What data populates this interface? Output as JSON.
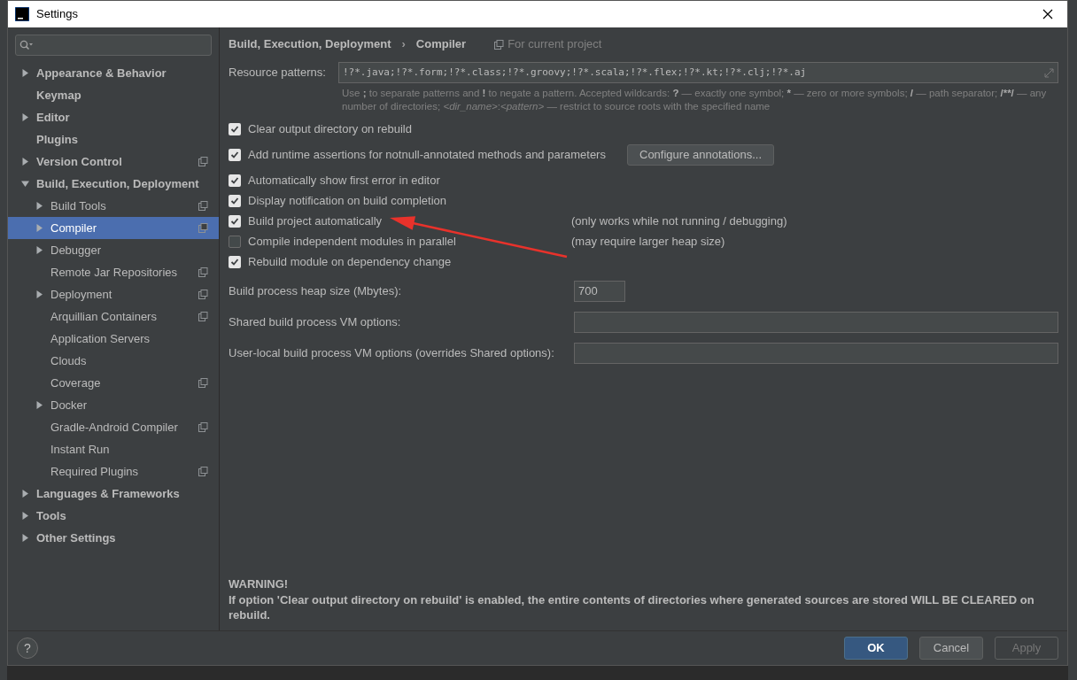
{
  "window": {
    "title": "Settings"
  },
  "sidebar": {
    "items": [
      {
        "label": "Appearance & Behavior",
        "expanded": false,
        "project": false,
        "selected": false
      },
      {
        "label": "Keymap",
        "project": false,
        "selected": false
      },
      {
        "label": "Editor",
        "expanded": false,
        "project": false,
        "selected": false
      },
      {
        "label": "Plugins",
        "project": false,
        "selected": false
      },
      {
        "label": "Version Control",
        "expanded": false,
        "project": true,
        "selected": false
      },
      {
        "label": "Build, Execution, Deployment",
        "expanded": true,
        "project": false,
        "selected": false,
        "children": [
          {
            "label": "Build Tools",
            "expanded": false,
            "project": true,
            "selected": false
          },
          {
            "label": "Compiler",
            "expanded": false,
            "project": true,
            "selected": true
          },
          {
            "label": "Debugger",
            "expanded": false,
            "project": false,
            "selected": false
          },
          {
            "label": "Remote Jar Repositories",
            "project": true,
            "selected": false
          },
          {
            "label": "Deployment",
            "expanded": false,
            "project": true,
            "selected": false
          },
          {
            "label": "Arquillian Containers",
            "project": true,
            "selected": false
          },
          {
            "label": "Application Servers",
            "project": false,
            "selected": false
          },
          {
            "label": "Clouds",
            "project": false,
            "selected": false
          },
          {
            "label": "Coverage",
            "project": true,
            "selected": false
          },
          {
            "label": "Docker",
            "expanded": false,
            "project": false,
            "selected": false
          },
          {
            "label": "Gradle-Android Compiler",
            "project": true,
            "selected": false
          },
          {
            "label": "Instant Run",
            "project": false,
            "selected": false
          },
          {
            "label": "Required Plugins",
            "project": true,
            "selected": false
          }
        ]
      },
      {
        "label": "Languages & Frameworks",
        "expanded": false,
        "project": false,
        "selected": false
      },
      {
        "label": "Tools",
        "expanded": false,
        "project": false,
        "selected": false
      },
      {
        "label": "Other Settings",
        "expanded": false,
        "project": false,
        "selected": false
      }
    ]
  },
  "breadcrumb": [
    "Build, Execution, Deployment",
    "›",
    "Compiler"
  ],
  "scope": "For current project",
  "resource_patterns": {
    "label": "Resource patterns:",
    "value": "!?*.java;!?*.form;!?*.class;!?*.groovy;!?*.scala;!?*.flex;!?*.kt;!?*.clj;!?*.aj",
    "hint": [
      {
        "text": "Use ",
        "kind": "text"
      },
      {
        "text": ";",
        "kind": "symbol"
      },
      {
        "text": " to separate patterns and ",
        "kind": "text"
      },
      {
        "text": "!",
        "kind": "symbol"
      },
      {
        "text": " to negate a pattern. Accepted wildcards: ",
        "kind": "text"
      },
      {
        "text": "?",
        "kind": "symbol"
      },
      {
        "text": " — exactly one symbol; ",
        "kind": "text"
      },
      {
        "text": "*",
        "kind": "symbol"
      },
      {
        "text": " — zero or more symbols; ",
        "kind": "text"
      },
      {
        "text": "/",
        "kind": "symbol"
      },
      {
        "text": " — path separator; ",
        "kind": "text"
      },
      {
        "text": "/**/",
        "kind": "symbol"
      },
      {
        "text": " — any number of directories; ",
        "kind": "text"
      },
      {
        "text": "<dir_name>",
        "kind": "placeholder"
      },
      {
        "text": ":",
        "kind": "text"
      },
      {
        "text": "<pattern>",
        "kind": "placeholder"
      },
      {
        "text": " — restrict to source roots with the specified name",
        "kind": "text"
      }
    ]
  },
  "options": [
    {
      "label": "Clear output directory on rebuild",
      "checked": true
    },
    {
      "label": "Add runtime assertions for notnull-annotated methods and parameters",
      "checked": true,
      "button": "Configure annotations..."
    },
    {
      "label": "Automatically show first error in editor",
      "checked": true
    },
    {
      "label": "Display notification on build completion",
      "checked": true
    },
    {
      "label": "Build project automatically",
      "checked": true,
      "note": "(only works while not running / debugging)"
    },
    {
      "label": "Compile independent modules in parallel",
      "checked": false,
      "note": "(may require larger heap size)"
    },
    {
      "label": "Rebuild module on dependency change",
      "checked": true
    }
  ],
  "fields": [
    {
      "label": "Build process heap size (Mbytes):",
      "value": "700",
      "kind": "short"
    },
    {
      "label": "Shared build process VM options:",
      "kind": "wide"
    },
    {
      "label": "User-local build process VM options (overrides Shared options):",
      "kind": "wide"
    }
  ],
  "warning": {
    "title": "WARNING!",
    "text": "If option 'Clear output directory on rebuild' is enabled, the entire contents of directories where generated sources are stored WILL BE CLEARED on rebuild."
  },
  "buttons": [
    {
      "label": "OK",
      "kind": "primary",
      "disabled": false
    },
    {
      "label": "Cancel",
      "kind": "normal",
      "disabled": false
    },
    {
      "label": "Apply",
      "kind": "normal",
      "disabled": true
    }
  ],
  "help": "?"
}
